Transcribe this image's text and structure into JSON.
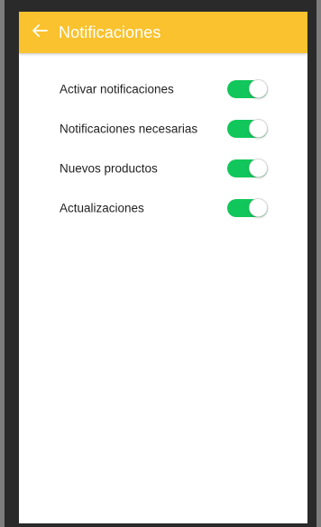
{
  "app_bar": {
    "title": "Notificaciones",
    "back_icon": "arrow-left-icon",
    "color": "#f9c22e"
  },
  "settings": [
    {
      "label": "Activar notificaciones",
      "enabled": true
    },
    {
      "label": "Notificaciones necesarias",
      "enabled": true
    },
    {
      "label": "Nuevos productos",
      "enabled": true
    },
    {
      "label": "Actualizaciones",
      "enabled": true
    }
  ],
  "colors": {
    "toggle_on": "#11c75b",
    "background_outer": "#7d7d7d"
  }
}
